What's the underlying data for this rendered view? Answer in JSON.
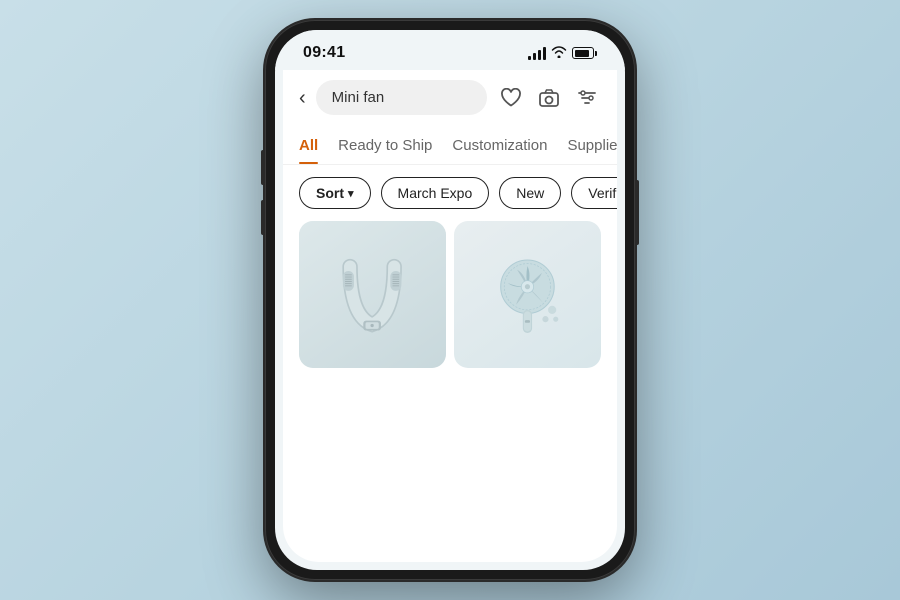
{
  "statusBar": {
    "time": "09:41"
  },
  "searchBar": {
    "back_label": "‹",
    "query": "Mini fan",
    "wish_icon": "♡",
    "camera_icon": "⊙",
    "filter_icon": "⊟"
  },
  "tabs": [
    {
      "id": "all",
      "label": "All",
      "active": true
    },
    {
      "id": "ready",
      "label": "Ready to Ship",
      "active": false
    },
    {
      "id": "custom",
      "label": "Customization",
      "active": false
    },
    {
      "id": "suppliers",
      "label": "Suppliers",
      "active": false
    }
  ],
  "filters": [
    {
      "id": "sort",
      "label": "Sort",
      "has_dropdown": true
    },
    {
      "id": "march_expo",
      "label": "March Expo",
      "has_dropdown": false
    },
    {
      "id": "new",
      "label": "New",
      "has_dropdown": false
    },
    {
      "id": "verified",
      "label": "Verified supplie…",
      "has_dropdown": false
    }
  ],
  "products": [
    {
      "id": "neck-fan",
      "alt": "Neck bladeless fan"
    },
    {
      "id": "handheld-fan",
      "alt": "Handheld mini fan"
    }
  ]
}
